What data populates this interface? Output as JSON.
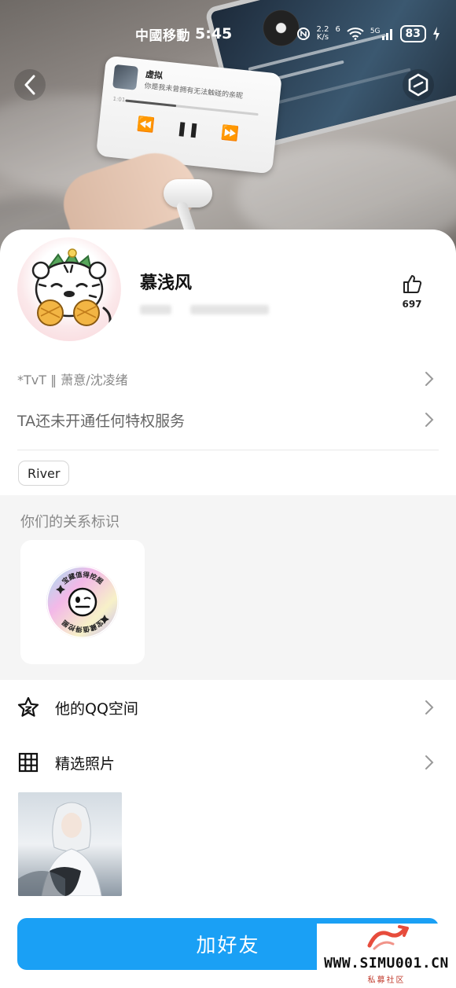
{
  "status_bar": {
    "carrier": "中國移動",
    "time": "5:45",
    "net_speed_value": "2.2",
    "net_speed_unit": "K/s",
    "sim": "6",
    "signal": "5G",
    "battery": "83"
  },
  "cover_music": {
    "song": "虚拟",
    "lyric": "你是我未曾拥有无法触碰的亲昵",
    "time": "1:01"
  },
  "profile": {
    "nickname": "慕浅风",
    "like_count": "697",
    "signature": "*TvT ‖ 萧意/沈凌绪",
    "privilege_text": "TA还未开通任何特权服务",
    "tag": "River"
  },
  "relation": {
    "title": "你们的关系标识",
    "badge_text_top": "宝藏值得挖掘",
    "badge_text_bottom": "宝藏值得挖掘"
  },
  "menu": {
    "qzone_label": "他的QQ空间",
    "photos_label": "精选照片"
  },
  "actions": {
    "add_friend": "加好友"
  },
  "watermark": {
    "url": "WWW.SIMU001.CN",
    "sub": "私募社区"
  },
  "colors": {
    "primary_button": "#1aa0f5",
    "relation_bg": "#f5f5f5"
  },
  "icons": [
    "back-arrow-icon",
    "hexagon-menu-icon",
    "thumbs-up-icon",
    "chevron-right-icon",
    "star-icon",
    "grid-icon"
  ]
}
